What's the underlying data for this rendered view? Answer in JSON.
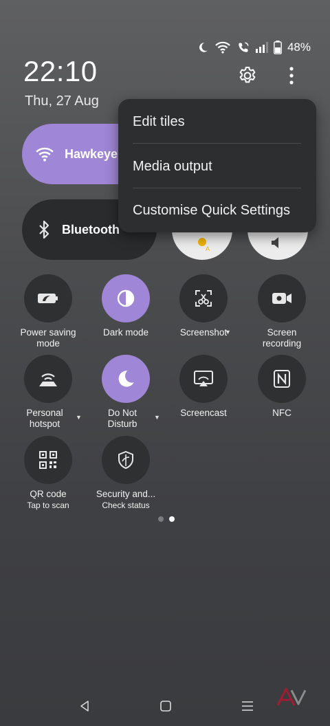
{
  "status_bar": {
    "battery_percent": "48%"
  },
  "header": {
    "time": "22:10",
    "date": "Thu, 27 Aug"
  },
  "big_tiles": {
    "wifi_label": "Hawkeye",
    "bluetooth_label": "Bluetooth"
  },
  "menu": {
    "items": [
      "Edit tiles",
      "Media output",
      "Customise Quick Settings"
    ]
  },
  "tiles": [
    {
      "label": "Power saving mode",
      "l1": "Power saving",
      "l2": "mode"
    },
    {
      "label": "Dark mode",
      "l1": "Dark mode",
      "l2": ""
    },
    {
      "label": "Screenshot",
      "l1": "Screenshot",
      "l2": ""
    },
    {
      "label": "Screen recording",
      "l1": "Screen",
      "l2": "recording"
    },
    {
      "label": "Personal hotspot",
      "l1": "Personal",
      "l2": "hotspot"
    },
    {
      "label": "Do Not Disturb",
      "l1": "Do Not",
      "l2": "Disturb"
    },
    {
      "label": "Screencast",
      "l1": "Screencast",
      "l2": ""
    },
    {
      "label": "NFC",
      "l1": "NFC",
      "l2": ""
    },
    {
      "label": "QR code",
      "l1": "QR code",
      "l2": "Tap to scan"
    },
    {
      "label": "Security and...",
      "l1": "Security and...",
      "l2": "Check status"
    }
  ],
  "colors": {
    "accent": "#9f86d6",
    "tile_off": "#2f3032",
    "menu_bg": "#2d2e30"
  }
}
